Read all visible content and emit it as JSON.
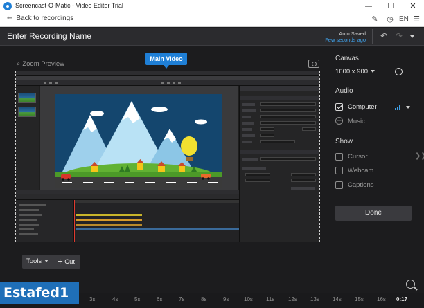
{
  "window": {
    "title": "Screencast-O-Matic - Video Editor Trial",
    "buttons": [
      "minimize",
      "maximize",
      "close"
    ]
  },
  "nav": {
    "back_label": "Back to recordings",
    "language": "EN"
  },
  "header": {
    "recording_name": "Enter Recording Name",
    "autosave_label": "Auto Saved",
    "autosave_time": "Few seconds ago"
  },
  "preview": {
    "zoom_label": "Zoom Preview",
    "main_video_label": "Main Video"
  },
  "canvas": {
    "title": "Canvas",
    "size": "1600 x 900"
  },
  "audio": {
    "title": "Audio",
    "computer_label": "Computer",
    "computer_checked": true,
    "music_label": "Music"
  },
  "show": {
    "title": "Show",
    "options": [
      {
        "label": "Cursor",
        "checked": false
      },
      {
        "label": "Webcam",
        "checked": false
      },
      {
        "label": "Captions",
        "checked": false
      }
    ]
  },
  "done_label": "Done",
  "tools": {
    "tools_label": "Tools",
    "cut_label": "Cut"
  },
  "watermark_text": "Estafed1",
  "timeline_ticks": [
    "3s",
    "4s",
    "5s",
    "6s",
    "7s",
    "8s",
    "9s",
    "10s",
    "11s",
    "12s",
    "13s",
    "14s",
    "15s",
    "16s"
  ],
  "timeline_end": "0:17",
  "colors": {
    "accent": "#1f7fd6",
    "link": "#3fa0e8",
    "background": "#1c1c1e"
  }
}
